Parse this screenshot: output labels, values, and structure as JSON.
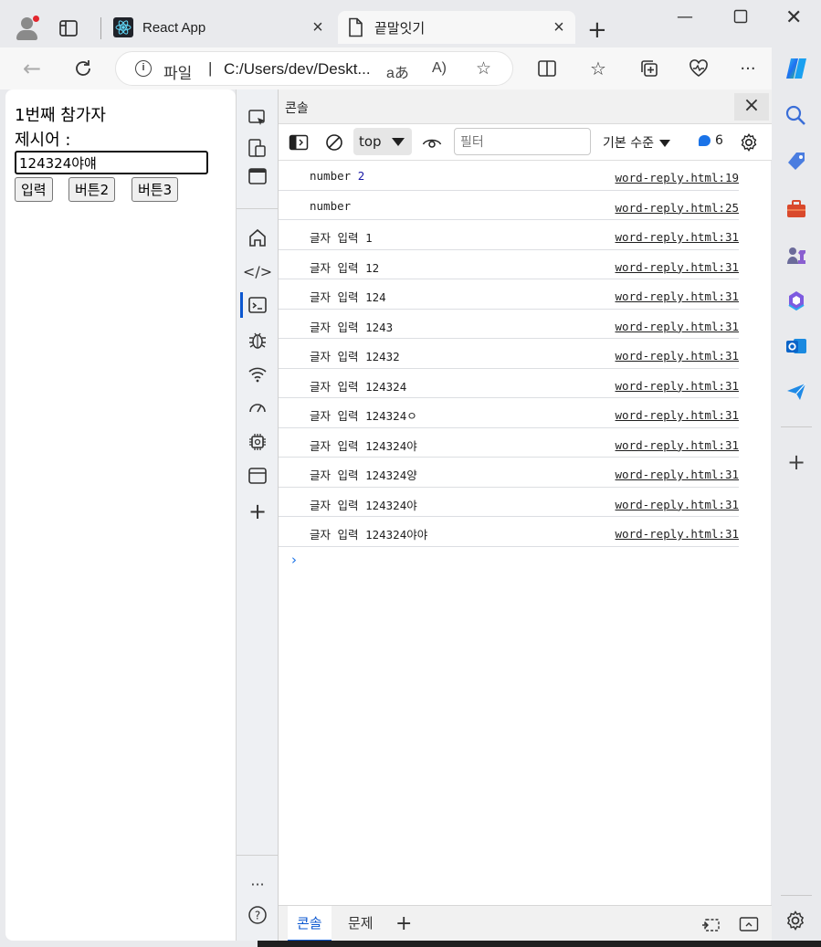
{
  "tabs": [
    {
      "title": "React App"
    },
    {
      "title": "끝말잇기"
    }
  ],
  "address": {
    "prefix": "파일",
    "url": "C:/Users/dev/Deskt..."
  },
  "page": {
    "participant": "1번째 참가자",
    "word_label": "제시어 :",
    "input_value": "124324야얘",
    "buttons": [
      "입력",
      "버튼2",
      "버튼3"
    ]
  },
  "devtools": {
    "panel_title": "콘솔",
    "context": "top",
    "filter_placeholder": "필터",
    "level": "기본 수준",
    "issues_count": "6",
    "logs": [
      {
        "text": "number",
        "value": "2",
        "source": "word-reply.html:19"
      },
      {
        "text": "number",
        "value": "",
        "source": "word-reply.html:25"
      },
      {
        "text": "글자 입력",
        "value": "1",
        "source": "word-reply.html:31"
      },
      {
        "text": "글자 입력",
        "value": "12",
        "source": "word-reply.html:31"
      },
      {
        "text": "글자 입력",
        "value": "124",
        "source": "word-reply.html:31"
      },
      {
        "text": "글자 입력",
        "value": "1243",
        "source": "word-reply.html:31"
      },
      {
        "text": "글자 입력",
        "value": "12432",
        "source": "word-reply.html:31"
      },
      {
        "text": "글자 입력",
        "value": "124324",
        "source": "word-reply.html:31"
      },
      {
        "text": "글자 입력",
        "value": "124324ㅇ",
        "source": "word-reply.html:31"
      },
      {
        "text": "글자 입력",
        "value": "124324야",
        "source": "word-reply.html:31"
      },
      {
        "text": "글자 입력",
        "value": "124324양",
        "source": "word-reply.html:31"
      },
      {
        "text": "글자 입력",
        "value": "124324야",
        "source": "word-reply.html:31"
      },
      {
        "text": "글자 입력",
        "value": "124324야야",
        "source": "word-reply.html:31"
      }
    ],
    "drawer_tabs": [
      "콘솔",
      "문제"
    ]
  },
  "colors": {
    "accent": "#1a73e8",
    "link_blue": "#0b57d0"
  }
}
